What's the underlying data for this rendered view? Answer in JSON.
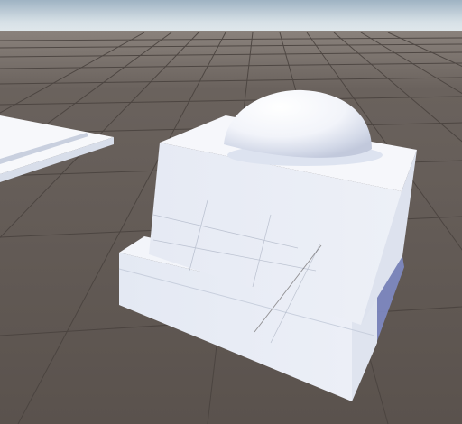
{
  "scene": {
    "view": "unity-scene-view",
    "colors": {
      "sky_top": "#9fb3c3",
      "sky_horizon": "#e4ebee",
      "ground": "#5e5651",
      "grid_line": "#4a433f",
      "object_light": "#ffffff",
      "object_mid": "#e8ecf4",
      "object_shade": "#d9dfeb",
      "shadow": "#7f8bc5"
    },
    "objects": [
      {
        "name": "plane-slab",
        "primitive": "cube"
      },
      {
        "name": "base-block",
        "primitive": "cube"
      },
      {
        "name": "pedestal-cube",
        "primitive": "cube"
      },
      {
        "name": "dome",
        "primitive": "sphere"
      }
    ]
  }
}
